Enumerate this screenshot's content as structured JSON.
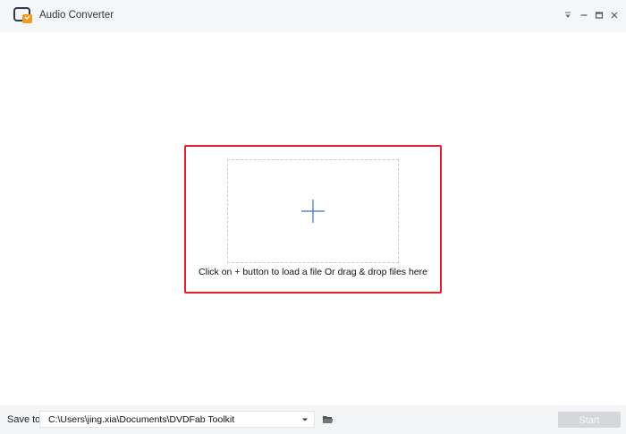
{
  "window": {
    "title": "Audio Converter",
    "icons": {
      "logo": "audio-converter-logo-icon",
      "menu": "menu-dropdown-icon",
      "minimize": "minimize-icon",
      "maximize": "maximize-icon",
      "close": "close-icon"
    }
  },
  "main": {
    "drop_hint": "Click on + button to load a file Or drag & drop files here",
    "add_icon": "plus-icon",
    "highlight_color": "#e0202a"
  },
  "footer": {
    "save_label": "Save to:",
    "save_path": "C:\\Users\\jing.xia\\Documents\\DVDFab Toolkit",
    "browse_icon": "folder-open-icon",
    "start_label": "Start"
  },
  "colors": {
    "accent": "#3a6fc4",
    "highlight": "#e0202a",
    "disabled_button": "#d5d7da"
  }
}
